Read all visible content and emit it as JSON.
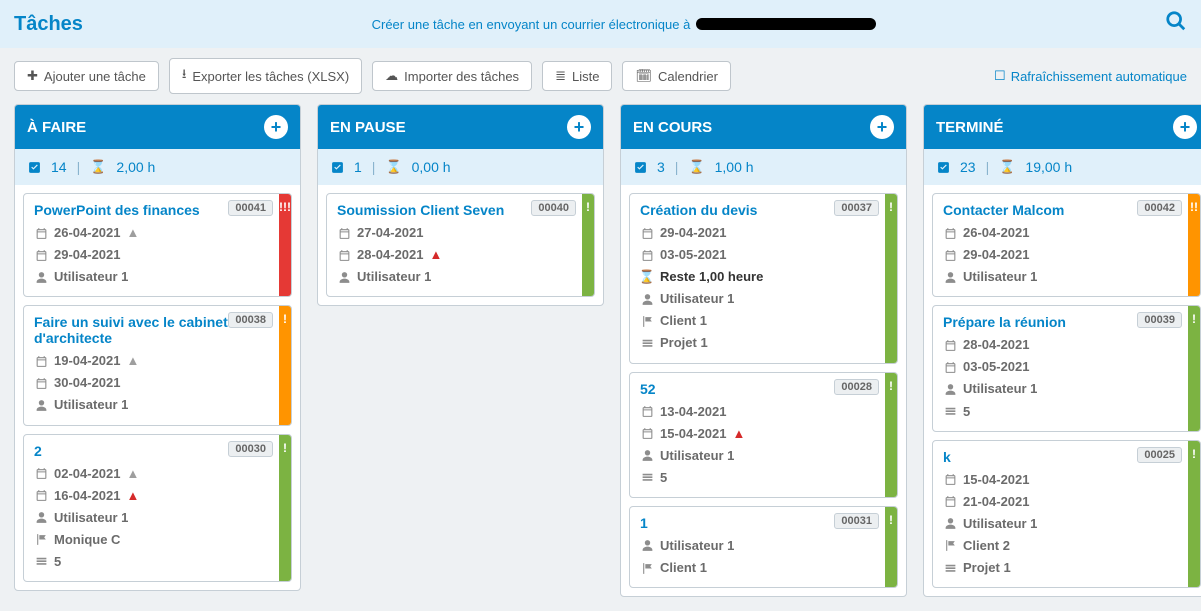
{
  "header": {
    "title": "Tâches",
    "subtitle": "Créer une tâche en envoyant un courrier électronique à"
  },
  "toolbar": {
    "add": "Ajouter une tâche",
    "export": "Exporter les tâches (XLSX)",
    "import": "Importer des tâches",
    "list": "Liste",
    "calendar": "Calendrier",
    "auto_refresh": "Rafraîchissement automatique"
  },
  "columns": [
    {
      "title": "À FAIRE",
      "count": "14",
      "hours": "2,00 h",
      "cards": [
        {
          "title": "PowerPoint des finances",
          "id": "00041",
          "stripe": "red",
          "bang": "!!!",
          "rows": [
            {
              "icon": "cal",
              "text": "26-04-2021",
              "warn": "g"
            },
            {
              "icon": "cal",
              "text": "29-04-2021"
            },
            {
              "icon": "user",
              "text": "Utilisateur 1"
            }
          ]
        },
        {
          "title": "Faire un suivi avec le cabinet d'architecte",
          "id": "00038",
          "stripe": "orange",
          "bang": "!",
          "rows": [
            {
              "icon": "cal",
              "text": "19-04-2021",
              "warn": "g"
            },
            {
              "icon": "cal",
              "text": "30-04-2021"
            },
            {
              "icon": "user",
              "text": "Utilisateur 1"
            }
          ]
        },
        {
          "title": "2",
          "id": "00030",
          "stripe": "green",
          "bang": "!",
          "rows": [
            {
              "icon": "cal",
              "text": "02-04-2021",
              "warn": "g"
            },
            {
              "icon": "cal",
              "text": "16-04-2021",
              "warn": "r"
            },
            {
              "icon": "user",
              "text": "Utilisateur 1"
            },
            {
              "icon": "flag",
              "text": "Monique C"
            },
            {
              "icon": "bars",
              "text": "5"
            }
          ]
        }
      ]
    },
    {
      "title": "EN PAUSE",
      "count": "1",
      "hours": "0,00 h",
      "cards": [
        {
          "title": "Soumission Client Seven",
          "id": "00040",
          "stripe": "green",
          "bang": "!",
          "rows": [
            {
              "icon": "cal",
              "text": "27-04-2021"
            },
            {
              "icon": "cal",
              "text": "28-04-2021",
              "warn": "r"
            },
            {
              "icon": "user",
              "text": "Utilisateur 1"
            }
          ]
        }
      ]
    },
    {
      "title": "EN COURS",
      "count": "3",
      "hours": "1,00 h",
      "cards": [
        {
          "title": "Création du devis",
          "id": "00037",
          "stripe": "green",
          "bang": "!",
          "rows": [
            {
              "icon": "cal",
              "text": "29-04-2021"
            },
            {
              "icon": "cal",
              "text": "03-05-2021"
            },
            {
              "icon": "hour",
              "text": "Reste 1,00 heure",
              "dark": true
            },
            {
              "icon": "user",
              "text": "Utilisateur 1"
            },
            {
              "icon": "flag",
              "text": "Client 1"
            },
            {
              "icon": "bars",
              "text": "Projet 1"
            }
          ]
        },
        {
          "title": "52",
          "id": "00028",
          "stripe": "green",
          "bang": "!",
          "rows": [
            {
              "icon": "cal",
              "text": "13-04-2021"
            },
            {
              "icon": "cal",
              "text": "15-04-2021",
              "warn": "r"
            },
            {
              "icon": "user",
              "text": "Utilisateur 1"
            },
            {
              "icon": "bars",
              "text": "5"
            }
          ]
        },
        {
          "title": "1",
          "id": "00031",
          "stripe": "green",
          "bang": "!",
          "rows": [
            {
              "icon": "user",
              "text": "Utilisateur 1"
            },
            {
              "icon": "flag",
              "text": "Client 1"
            }
          ]
        }
      ]
    },
    {
      "title": "TERMINÉ",
      "count": "23",
      "hours": "19,00 h",
      "cards": [
        {
          "title": "Contacter Malcom",
          "id": "00042",
          "stripe": "orange",
          "bang": "!!",
          "rows": [
            {
              "icon": "cal",
              "text": "26-04-2021"
            },
            {
              "icon": "cal",
              "text": "29-04-2021"
            },
            {
              "icon": "user",
              "text": "Utilisateur 1"
            }
          ]
        },
        {
          "title": "Prépare la réunion",
          "id": "00039",
          "stripe": "green",
          "bang": "!",
          "rows": [
            {
              "icon": "cal",
              "text": "28-04-2021"
            },
            {
              "icon": "cal",
              "text": "03-05-2021"
            },
            {
              "icon": "user",
              "text": "Utilisateur 1"
            },
            {
              "icon": "bars",
              "text": "5"
            }
          ]
        },
        {
          "title": "k",
          "id": "00025",
          "stripe": "green",
          "bang": "!",
          "rows": [
            {
              "icon": "cal",
              "text": "15-04-2021"
            },
            {
              "icon": "cal",
              "text": "21-04-2021"
            },
            {
              "icon": "user",
              "text": "Utilisateur 1"
            },
            {
              "icon": "flag",
              "text": "Client 2"
            },
            {
              "icon": "bars",
              "text": "Projet 1"
            }
          ]
        }
      ]
    }
  ]
}
